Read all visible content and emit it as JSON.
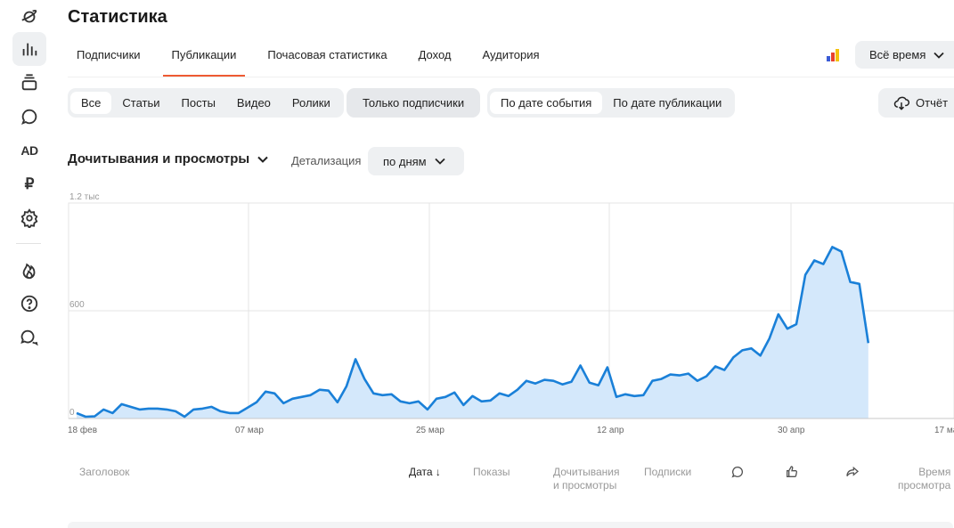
{
  "page": {
    "title": "Статистика"
  },
  "tabs": [
    "Подписчики",
    "Публикации",
    "Почасовая статистика",
    "Доход",
    "Аудитория"
  ],
  "active_tab": "Публикации",
  "period": {
    "label": "Всё время"
  },
  "content_filter": [
    "Все",
    "Статьи",
    "Посты",
    "Видео",
    "Ролики"
  ],
  "subscribers_filter": "Только подписчики",
  "date_mode": [
    "По дате события",
    "По дате публикации"
  ],
  "report_label": "Отчёт",
  "metric": {
    "label": "Дочитывания и просмотры"
  },
  "detail": {
    "label": "Детализация",
    "value": "по дням"
  },
  "sidebar_icons": [
    "planet-icon",
    "stats-icon",
    "publications-icon",
    "comments-icon",
    "ad-icon",
    "ruble-icon",
    "settings-icon",
    "fire-icon",
    "help-icon",
    "chat-icon"
  ],
  "sidebar_text": {
    "ad": "AD",
    "ruble": "₽"
  },
  "colors": {
    "accent": "#ee5a32",
    "line": "#1a80d8",
    "area": "#d4e8fb"
  },
  "table": {
    "headers": {
      "title": "Заголовок",
      "date": "Дата",
      "impressions": "Показы",
      "reads_l1": "Дочитывания",
      "reads_l2": "и просмотры",
      "subs": "Подписки",
      "time_l1": "Время",
      "time_l2": "просмотра"
    },
    "icon_columns": [
      "comment-icon",
      "like-icon",
      "share-icon"
    ]
  },
  "chart_data": {
    "type": "area",
    "x_ticks": [
      "18 фев",
      "07 мар",
      "25 мар",
      "12 апр",
      "30 апр",
      "17 ма"
    ],
    "y_ticks": [
      "0",
      "600",
      "1.2 тыс"
    ],
    "ylim": [
      0,
      1200
    ],
    "grid": true,
    "series": [
      {
        "values": [
          30,
          10,
          12,
          50,
          30,
          80,
          65,
          50,
          55,
          55,
          50,
          40,
          10,
          50,
          55,
          65,
          40,
          30,
          30,
          60,
          90,
          150,
          140,
          85,
          110,
          120,
          130,
          160,
          155,
          90,
          180,
          330,
          220,
          140,
          130,
          135,
          95,
          85,
          95,
          50,
          110,
          120,
          145,
          75,
          125,
          95,
          100,
          140,
          125,
          160,
          210,
          195,
          215,
          210,
          190,
          205,
          295,
          200,
          185,
          285,
          120,
          135,
          125,
          130,
          210,
          220,
          245,
          240,
          250,
          210,
          235,
          290,
          270,
          340,
          380,
          390,
          350,
          445,
          580,
          500,
          525,
          800,
          880,
          860,
          955,
          930,
          760,
          750,
          420
        ]
      }
    ]
  }
}
